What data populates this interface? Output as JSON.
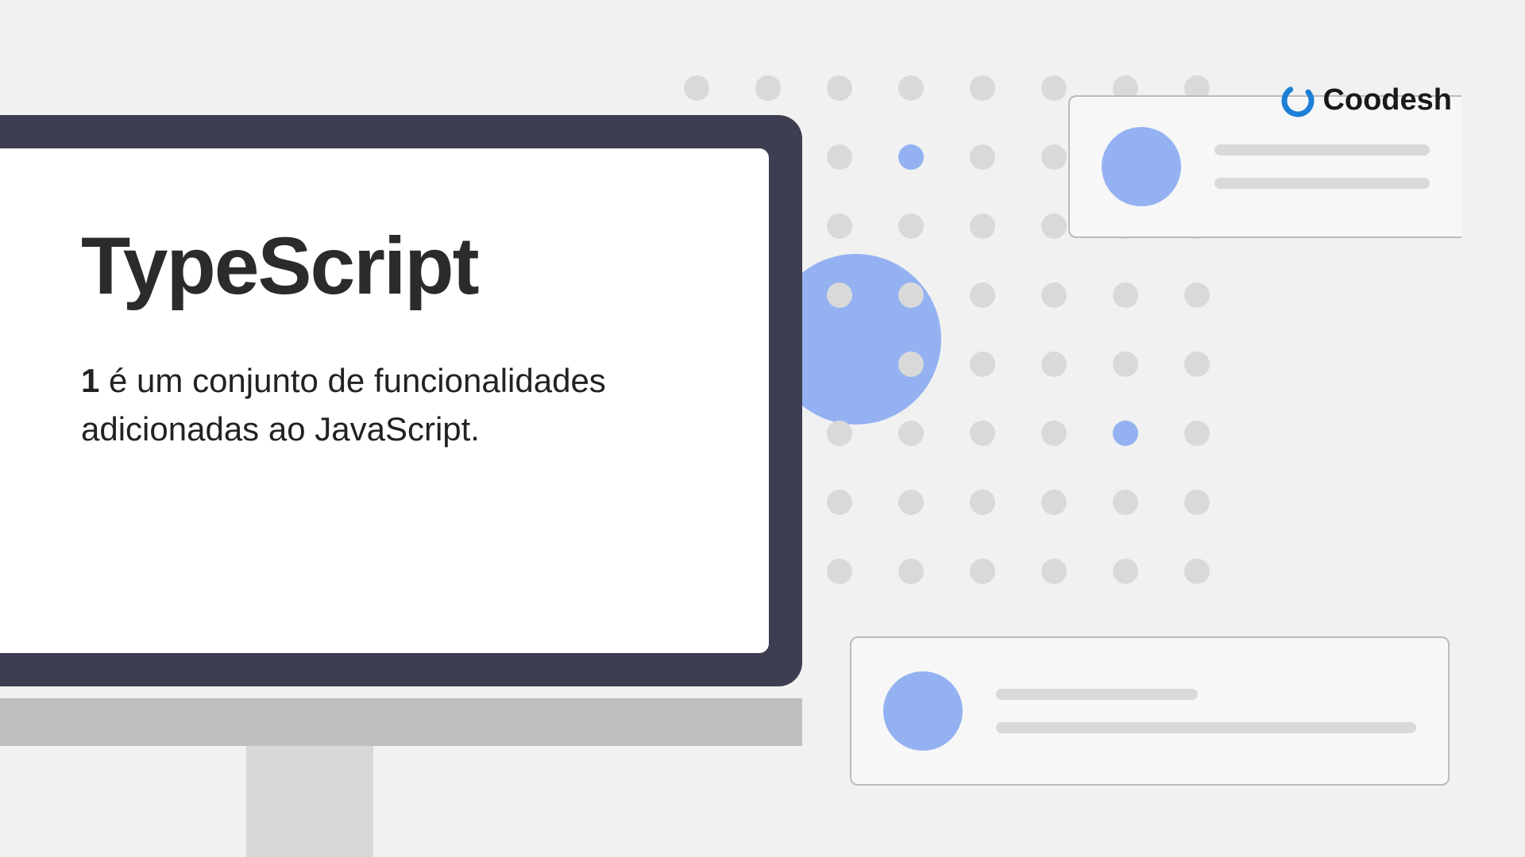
{
  "title": "TypeScript",
  "definition": {
    "number": "1",
    "text": "é um conjunto de funcionalidades adicionadas ao JavaScript."
  },
  "brand": {
    "name": "Coodesh",
    "accent_color": "#1e7fd6"
  },
  "dots": {
    "rows": 8,
    "cols": 8,
    "blue_positions": [
      [
        1,
        3
      ],
      [
        4,
        2
      ],
      [
        5,
        6
      ]
    ]
  }
}
